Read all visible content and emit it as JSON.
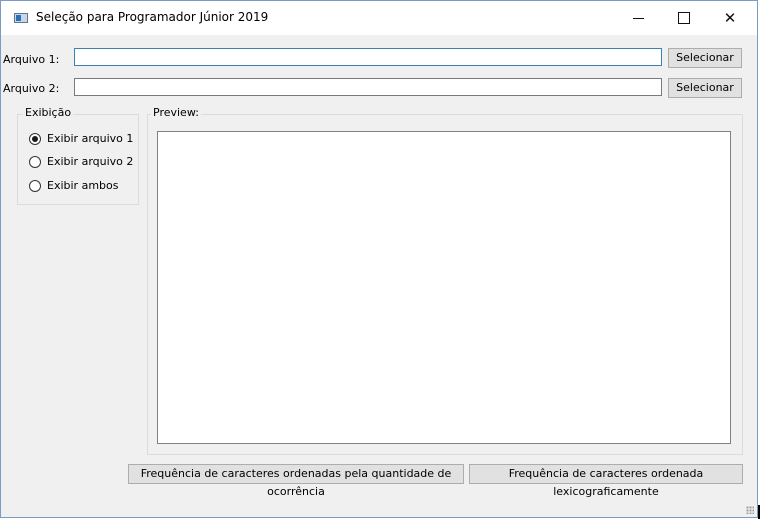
{
  "window": {
    "title": "Seleção para Programador Júnior 2019",
    "controls": {
      "minimize": "—",
      "maximize": "☐",
      "close": "✕"
    }
  },
  "files": {
    "arquivo1_label": "Arquivo 1:",
    "arquivo1_value": "",
    "arquivo2_label": "Arquivo 2:",
    "arquivo2_value": "",
    "select_label_1": "Selecionar",
    "select_label_2": "Selecionar"
  },
  "exibicao": {
    "title": "Exibição",
    "options": [
      {
        "label": "Exibir arquivo 1",
        "checked": true
      },
      {
        "label": "Exibir arquivo 2",
        "checked": false
      },
      {
        "label": "Exibir ambos",
        "checked": false
      }
    ]
  },
  "preview": {
    "title": "Preview:",
    "content": ""
  },
  "actions": {
    "freq_occurrence": "Frequência de caracteres ordenadas pela quantidade de ocorrência",
    "freq_lexico": "Frequência de caracteres ordenada lexicograficamente"
  },
  "colors": {
    "accent_border": "#3c7fb1",
    "window_bg": "#f0f0f0",
    "button_bg": "#e1e1e1"
  }
}
